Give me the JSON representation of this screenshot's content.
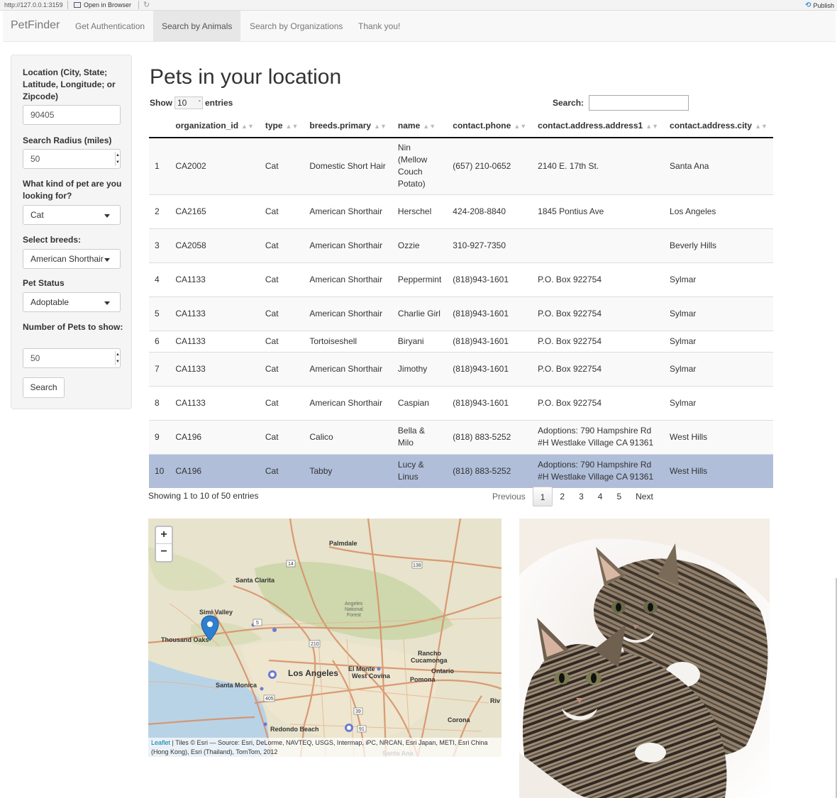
{
  "browser": {
    "url": "http://127.0.0.1:3159",
    "open_in_browser": "Open in Browser",
    "publish": "Publish"
  },
  "navbar": {
    "brand": "PetFinder",
    "items": [
      {
        "label": "Get Authentication"
      },
      {
        "label": "Search by Animals",
        "active": true
      },
      {
        "label": "Search by Organizations"
      },
      {
        "label": "Thank you!"
      }
    ]
  },
  "sidebar": {
    "location_label": "Location (City, State; Latitude, Longitude; or Zipcode)",
    "location_value": "90405",
    "radius_label": "Search Radius (miles)",
    "radius_value": "50",
    "type_label": "What kind of pet are you looking for?",
    "type_value": "Cat",
    "breeds_label": "Select breeds:",
    "breeds_value": "American Shorthair",
    "status_label": "Pet Status",
    "status_value": "Adoptable",
    "count_label": "Number of Pets to show:",
    "count_value": "50",
    "search_button": "Search"
  },
  "main": {
    "title": "Pets in your location",
    "show_label": "Show",
    "show_value": "10",
    "entries_label": "entries",
    "search_label": "Search:",
    "columns": [
      "",
      "organization_id",
      "type",
      "breeds.primary",
      "name",
      "contact.phone",
      "contact.address.address1",
      "contact.address.city"
    ],
    "rows": [
      [
        "1",
        "CA2002",
        "Cat",
        "Domestic Short Hair",
        "Nin (Mellow Couch Potato)",
        "(657) 210-0652",
        "2140 E. 17th St.",
        "Santa Ana"
      ],
      [
        "2",
        "CA2165",
        "Cat",
        "American Shorthair",
        "Herschel",
        "424-208-8840",
        "1845 Pontius Ave",
        "Los Angeles"
      ],
      [
        "3",
        "CA2058",
        "Cat",
        "American Shorthair",
        "Ozzie",
        "310-927-7350",
        "",
        "Beverly Hills"
      ],
      [
        "4",
        "CA1133",
        "Cat",
        "American Shorthair",
        "Peppermint",
        "(818)943-1601",
        "P.O. Box 922754",
        "Sylmar"
      ],
      [
        "5",
        "CA1133",
        "Cat",
        "American Shorthair",
        "Charlie Girl",
        "(818)943-1601",
        "P.O. Box 922754",
        "Sylmar"
      ],
      [
        "6",
        "CA1133",
        "Cat",
        "Tortoiseshell",
        "Biryani",
        "(818)943-1601",
        "P.O. Box 922754",
        "Sylmar"
      ],
      [
        "7",
        "CA1133",
        "Cat",
        "American Shorthair",
        "Jimothy",
        "(818)943-1601",
        "P.O. Box 922754",
        "Sylmar"
      ],
      [
        "8",
        "CA1133",
        "Cat",
        "American Shorthair",
        "Caspian",
        "(818)943-1601",
        "P.O. Box 922754",
        "Sylmar"
      ],
      [
        "9",
        "CA196",
        "Cat",
        "Calico",
        "Bella & Milo",
        "(818) 883-5252",
        "Adoptions: 790 Hampshire Rd #H Westlake Village CA 91361",
        "West Hills"
      ],
      [
        "10",
        "CA196",
        "Cat",
        "Tabby",
        "Lucy & Linus",
        "(818) 883-5252",
        "Adoptions: 790 Hampshire Rd #H Westlake Village CA 91361",
        "West Hills"
      ]
    ],
    "selected_row": 10,
    "info": "Showing 1 to 10 of 50 entries",
    "pager": {
      "previous": "Previous",
      "pages": [
        "1",
        "2",
        "3",
        "4",
        "5"
      ],
      "current": "1",
      "next": "Next"
    }
  },
  "map": {
    "zoom_in": "+",
    "zoom_out": "−",
    "places": [
      "Palmdale",
      "Santa Clarita",
      "Simi Valley",
      "Thousand Oaks",
      "Los Angeles",
      "El Monte",
      "West Covina",
      "Rancho Cucamonga",
      "Ontario",
      "Pomona",
      "Santa Monica",
      "Redondo Beach",
      "Corona",
      "Riv",
      "Santa Ana",
      "Angeles National Forest"
    ],
    "highways": [
      "14",
      "138",
      "5",
      "210",
      "405",
      "39",
      "91"
    ],
    "attribution_link": "Leaflet",
    "attribution_text": " | Tiles © Esri — Source: Esri, DeLorme, NAVTEQ, USGS, Intermap, iPC, NRCAN, Esri Japan, METI, Esri China (Hong Kong), Esri (Thailand), TomTom, 2012",
    "colors": {
      "land": "#e8e3cc",
      "water": "#b9d3e6",
      "forest": "#c9d6a6",
      "road": "#d8916a",
      "marker": "#2f7fd0"
    }
  },
  "photo": {
    "alt": "two tabby kittens"
  }
}
